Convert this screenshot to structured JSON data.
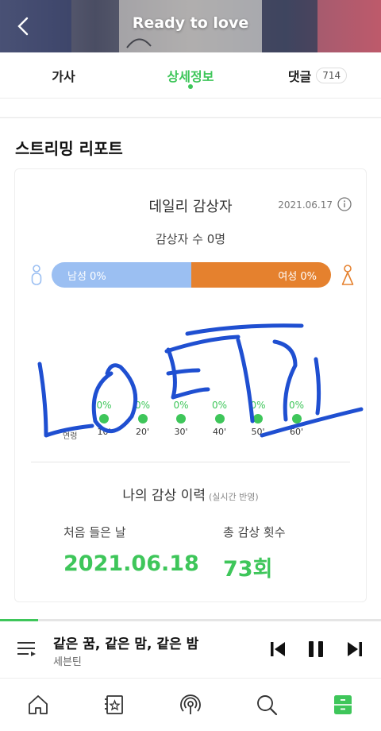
{
  "header": {
    "title": "Ready to love"
  },
  "tabs": [
    {
      "label": "가사"
    },
    {
      "label": "상세정보"
    },
    {
      "label": "댓글",
      "count": "714"
    }
  ],
  "report": {
    "section_title": "스트리밍 리포트",
    "daily_title": "데일리 감상자",
    "date": "2021.06.17",
    "listener_count": "감상자 수 0명",
    "male_label": "남성 0%",
    "female_label": "여성 0%",
    "male_share": 0.5,
    "age_caption": "연령",
    "ages": [
      {
        "label": "10'",
        "value": "0%"
      },
      {
        "label": "20'",
        "value": "0%"
      },
      {
        "label": "30'",
        "value": "0%"
      },
      {
        "label": "40'",
        "value": "0%"
      },
      {
        "label": "50'",
        "value": "0%"
      },
      {
        "label": "60'",
        "value": "0%"
      }
    ]
  },
  "history": {
    "title": "나의 감상 이력",
    "subtitle": "(실시간 반영)",
    "first_listen_label": "처음 들은 날",
    "first_listen_value": "2021.06.18",
    "total_plays_label": "총 감상 횟수",
    "total_plays_value": "73회"
  },
  "player": {
    "title": "같은 꿈, 같은 맘, 같은 밤",
    "artist": "세븐틴",
    "progress": 0.1
  },
  "nav": [
    "home-icon",
    "library-icon",
    "broadcast-icon",
    "search-icon",
    "storage-icon"
  ],
  "colors": {
    "accent": "#3ec65a",
    "male": "#9bbff2",
    "female": "#e5812e",
    "scribble": "#1f4fd1"
  }
}
